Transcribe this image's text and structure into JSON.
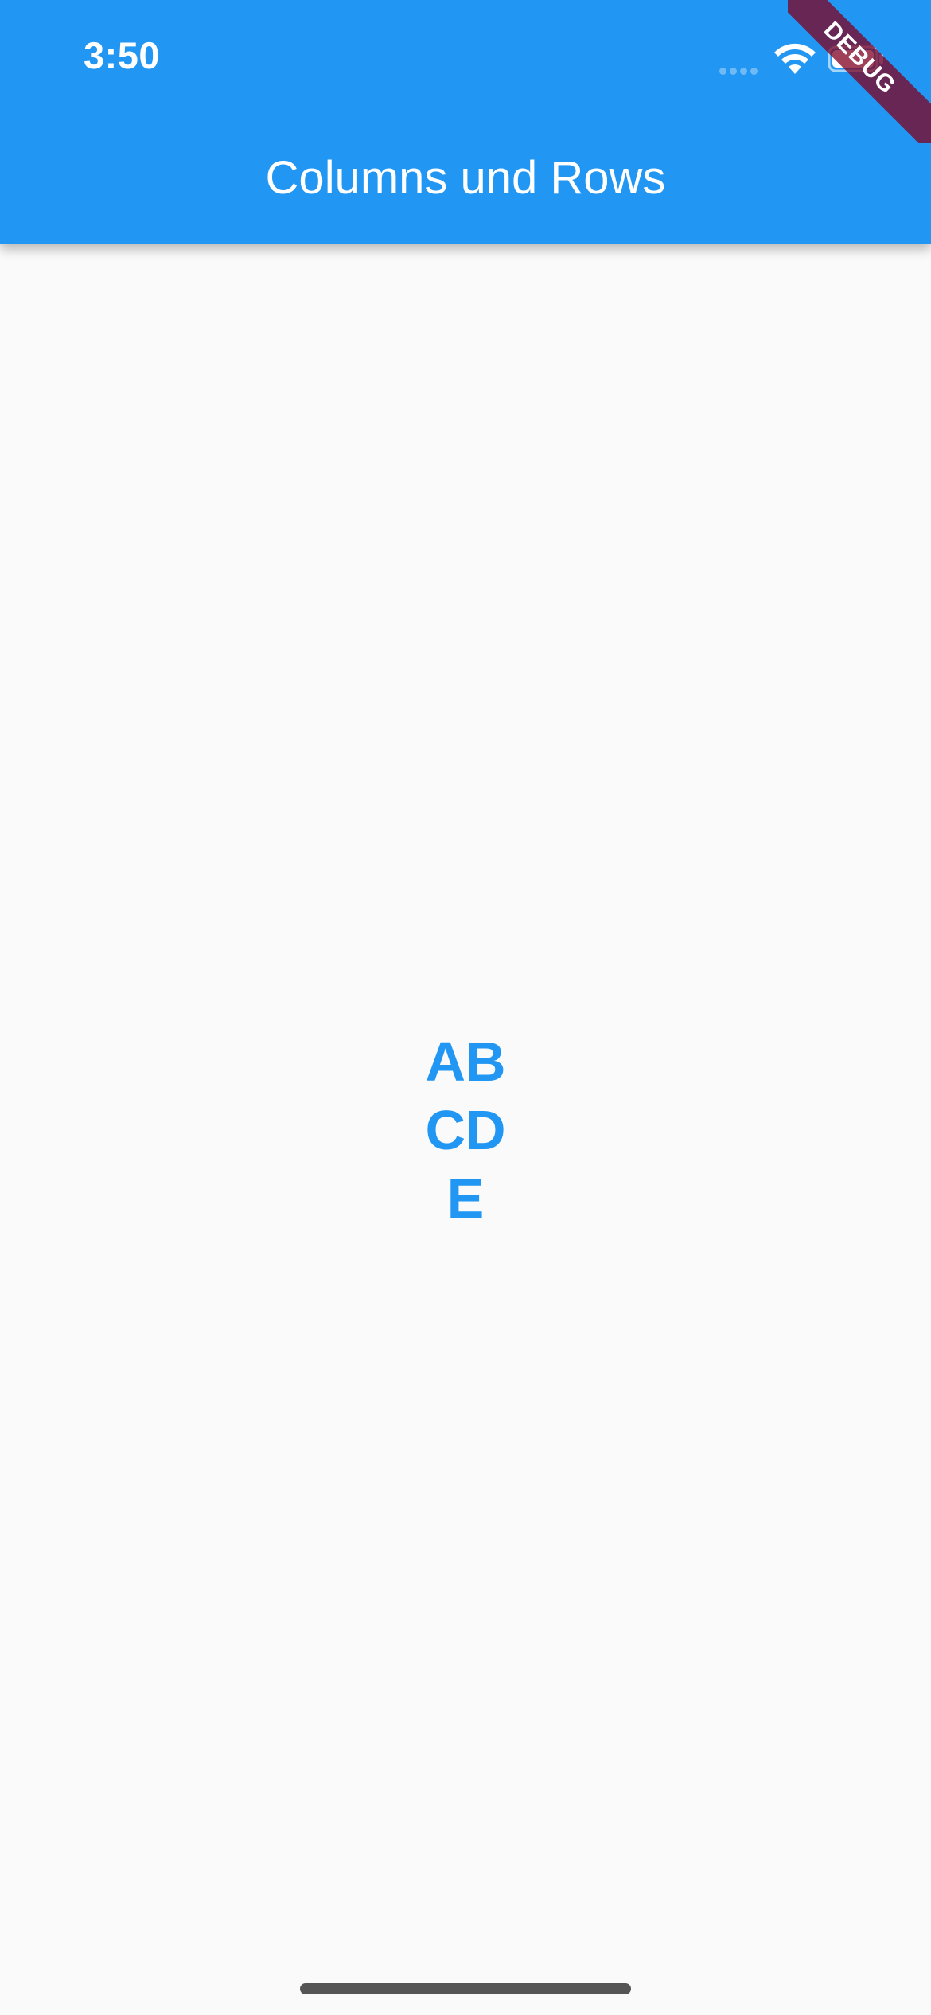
{
  "status_bar": {
    "time": "3:50"
  },
  "app_bar": {
    "title": "Columns und Rows",
    "color": "#2196f3"
  },
  "debug_banner": {
    "label": "DEBUG"
  },
  "content": {
    "rows": [
      {
        "letters": [
          "A",
          "B"
        ]
      },
      {
        "letters": [
          "C",
          "D"
        ]
      },
      {
        "letters": [
          "E"
        ]
      }
    ],
    "text_color": "#2196f3"
  },
  "icons": {
    "wifi": "wifi-icon",
    "battery": "battery-icon",
    "signal": "signal-icon"
  }
}
